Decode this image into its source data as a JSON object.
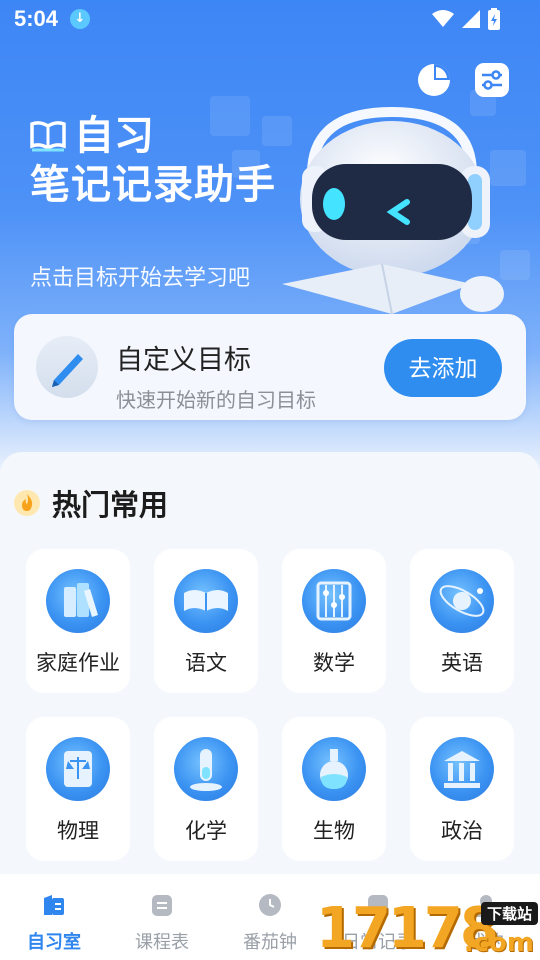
{
  "status": {
    "time": "5:04"
  },
  "hero": {
    "title_line1": "自习",
    "title_line2": "笔记记录助手",
    "subtitle": "点击目标开始去学习吧"
  },
  "goal_card": {
    "title": "自定义目标",
    "subtitle": "快速开始新的自习目标",
    "button": "去添加"
  },
  "hot": {
    "title": "热门常用",
    "items": [
      {
        "label": "家庭作业",
        "icon": "books-icon"
      },
      {
        "label": "语文",
        "icon": "open-book-icon"
      },
      {
        "label": "数学",
        "icon": "abacus-icon"
      },
      {
        "label": "英语",
        "icon": "globe-icon"
      },
      {
        "label": "物理",
        "icon": "scroll-scale-icon"
      },
      {
        "label": "化学",
        "icon": "test-tube-icon"
      },
      {
        "label": "生物",
        "icon": "flask-icon"
      },
      {
        "label": "政治",
        "icon": "building-icon"
      }
    ]
  },
  "tabs": [
    {
      "label": "自习室",
      "icon": "study-room-icon",
      "active": true
    },
    {
      "label": "课程表",
      "icon": "schedule-icon",
      "active": false
    },
    {
      "label": "番茄钟",
      "icon": "clock-icon",
      "active": false
    },
    {
      "label": "日常记录",
      "icon": "record-icon",
      "active": false
    },
    {
      "label": "我的",
      "icon": "profile-icon",
      "active": false
    }
  ],
  "watermark": {
    "digits": "17178",
    "suffix": ".com",
    "tag": "下载站"
  },
  "colors": {
    "primary": "#2f8df0",
    "hero_top": "#3d86f5",
    "tab_active": "#2f86ee",
    "tab_inactive": "#9aa0a8"
  }
}
